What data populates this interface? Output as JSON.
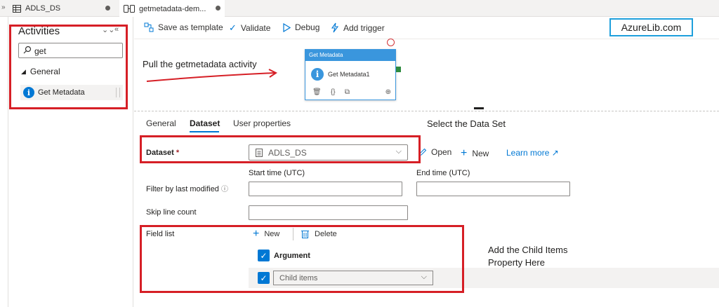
{
  "tabs": [
    {
      "label": "ADLS_DS"
    },
    {
      "label": "getmetadata-dem..."
    }
  ],
  "activities": {
    "title": "Activities",
    "search_value": "get",
    "group": "General",
    "item": "Get Metadata"
  },
  "toolbar": {
    "save_template": "Save as template",
    "validate": "Validate",
    "debug": "Debug",
    "add_trigger": "Add trigger"
  },
  "watermark": "AzureLib.com",
  "canvas": {
    "annotation_pull": "Pull the getmetadata activity",
    "card_header": "Get Metadata",
    "card_name": "Get Metadata1"
  },
  "properties": {
    "tabs": [
      "General",
      "Dataset",
      "User properties"
    ],
    "annotation_select": "Select the Data Set",
    "dataset_label": "Dataset",
    "dataset_value": "ADLS_DS",
    "open": "Open",
    "new": "New",
    "learn_more": "Learn more",
    "start_time_label": "Start time (UTC)",
    "end_time_label": "End time (UTC)",
    "filter_label": "Filter by last modified",
    "skip_label": "Skip line count",
    "field_list_label": "Field list",
    "field_new": "New",
    "field_delete": "Delete",
    "argument_header": "Argument",
    "child_items": "Child items",
    "annotation_child_1": "Add the Child Items",
    "annotation_child_2": "Property Here"
  },
  "colors": {
    "accent": "#0078d4",
    "highlight_box": "#d61f26",
    "watermark_border": "#1e9fdc"
  }
}
